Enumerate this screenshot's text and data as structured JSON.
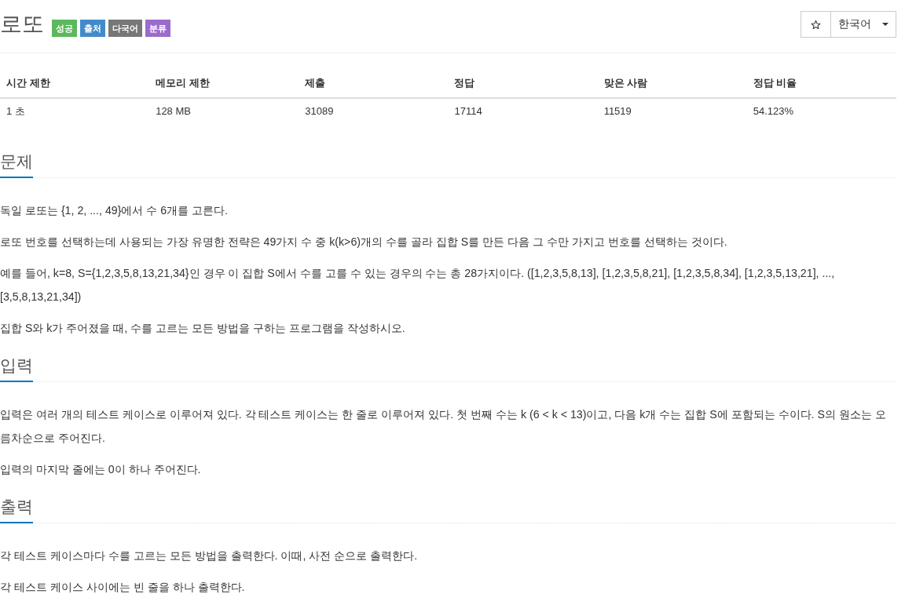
{
  "problem": {
    "title": "로또",
    "badges": [
      {
        "label": "성공",
        "color": "#5cb85c"
      },
      {
        "label": "출처",
        "color": "#428bca"
      },
      {
        "label": "다국어",
        "color": "#777777"
      },
      {
        "label": "분류",
        "color": "#9b6bcc"
      }
    ]
  },
  "language_select": {
    "value": "한국어"
  },
  "stats_table": {
    "columns": [
      "시간 제한",
      "메모리 제한",
      "제출",
      "정답",
      "맞은 사람",
      "정답 비율"
    ],
    "rows": [
      [
        "1 초",
        "128 MB",
        "31089",
        "17114",
        "11519",
        "54.123%"
      ]
    ]
  },
  "sections": [
    {
      "heading": "문제",
      "paragraphs": [
        "독일 로또는 {1, 2, ..., 49}에서 수 6개를 고른다.",
        "로또 번호를 선택하는데 사용되는 가장 유명한 전략은 49가지 수 중 k(k>6)개의 수를 골라 집합 S를 만든 다음 그 수만 가지고 번호를 선택하는 것이다.",
        "예를 들어, k=8, S={1,2,3,5,8,13,21,34}인 경우 이 집합 S에서 수를 고를 수 있는 경우의 수는 총 28가지이다. ([1,2,3,5,8,13], [1,2,3,5,8,21], [1,2,3,5,8,34], [1,2,3,5,13,21], ..., [3,5,8,13,21,34])",
        "집합 S와 k가 주어졌을 때, 수를 고르는 모든 방법을 구하는 프로그램을 작성하시오."
      ]
    },
    {
      "heading": "입력",
      "paragraphs": [
        "입력은 여러 개의 테스트 케이스로 이루어져 있다. 각 테스트 케이스는 한 줄로 이루어져 있다. 첫 번째 수는 k (6 < k < 13)이고, 다음 k개 수는 집합 S에 포함되는 수이다. S의 원소는 오름차순으로 주어진다.",
        "입력의 마지막 줄에는 0이 하나 주어진다."
      ]
    },
    {
      "heading": "출력",
      "paragraphs": [
        "각 테스트 케이스마다 수를 고르는 모든 방법을 출력한다. 이때, 사전 순으로 출력한다.",
        "각 테스트 케이스 사이에는 빈 줄을 하나 출력한다."
      ]
    }
  ]
}
